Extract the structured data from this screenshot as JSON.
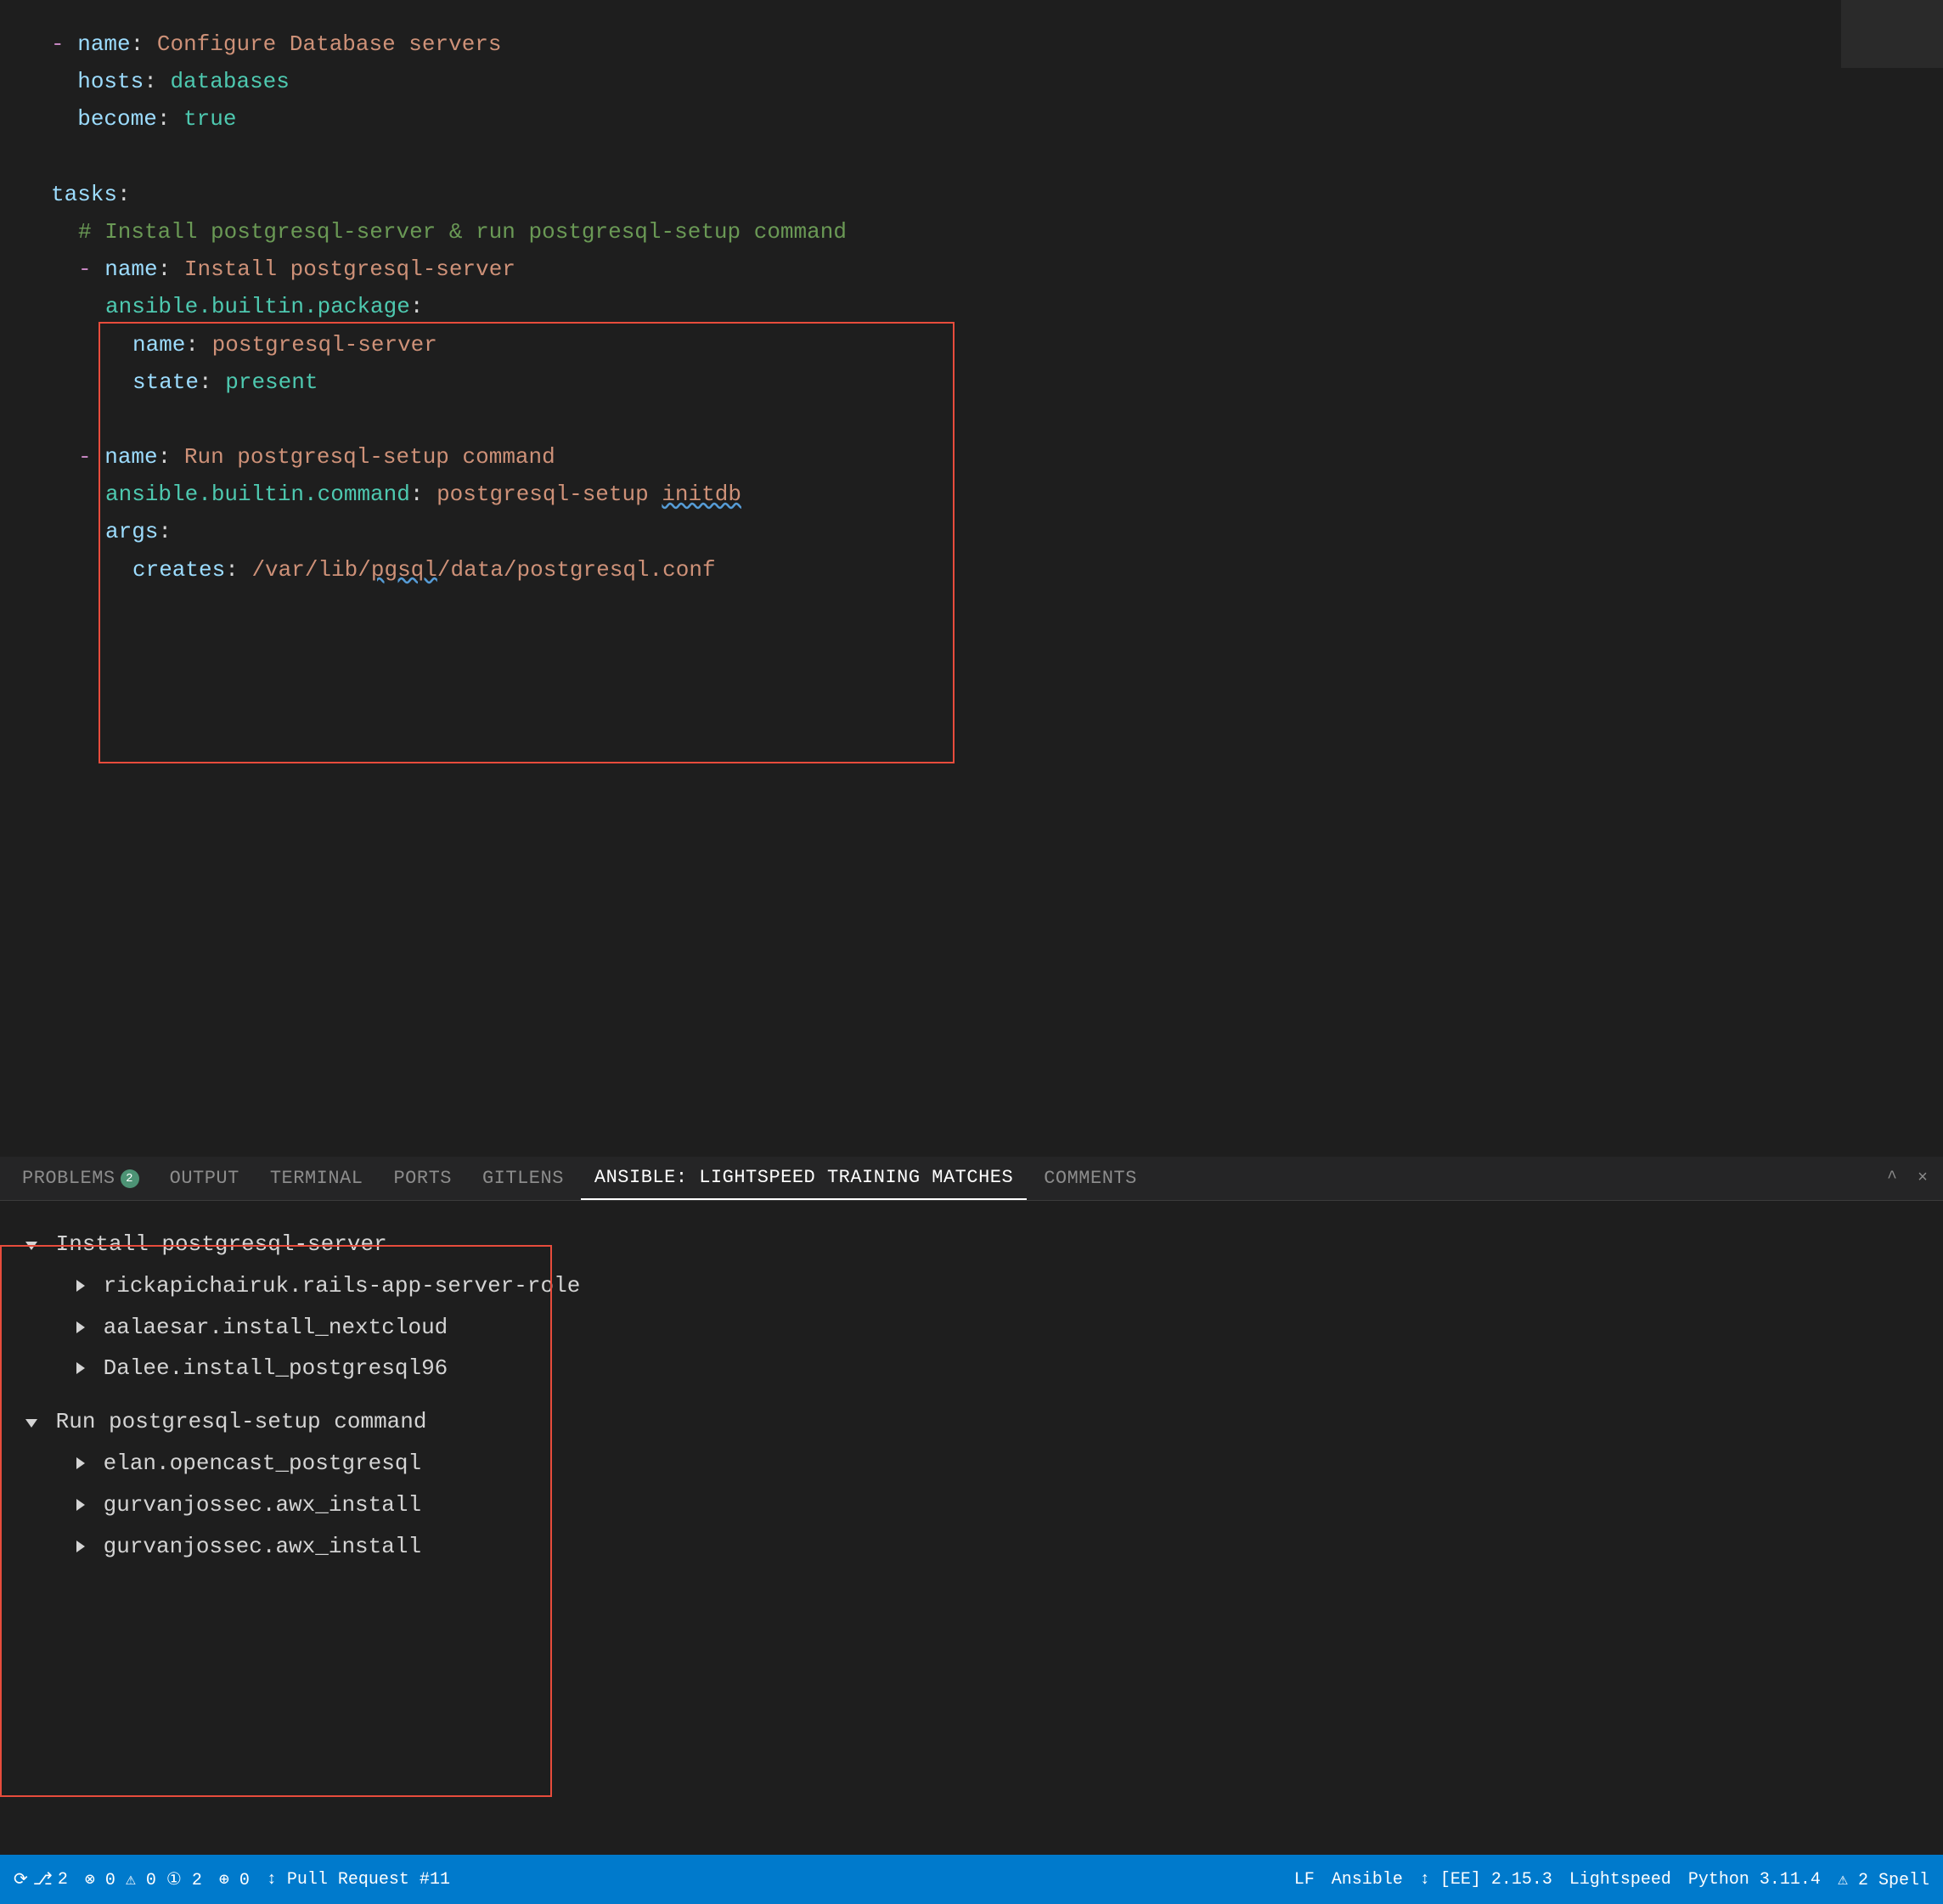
{
  "editor": {
    "lines": [
      {
        "indent": 0,
        "content": [
          {
            "type": "dash",
            "text": "- "
          },
          {
            "type": "key",
            "text": "name"
          },
          {
            "type": "plain",
            "text": ": "
          },
          {
            "type": "val-str",
            "text": "Configure Database servers"
          }
        ]
      },
      {
        "indent": 2,
        "content": [
          {
            "type": "key",
            "text": "hosts"
          },
          {
            "type": "plain",
            "text": ": "
          },
          {
            "type": "val-kw",
            "text": "databases"
          }
        ]
      },
      {
        "indent": 2,
        "content": [
          {
            "type": "key",
            "text": "become"
          },
          {
            "type": "plain",
            "text": ": "
          },
          {
            "type": "val-kw",
            "text": "true"
          }
        ]
      },
      {
        "indent": 0,
        "content": []
      },
      {
        "indent": 0,
        "content": [
          {
            "type": "key",
            "text": "tasks"
          },
          {
            "type": "plain",
            "text": ":"
          }
        ]
      },
      {
        "indent": 2,
        "content": [
          {
            "type": "comment",
            "text": "# Install postgresql-server & run postgresql-setup command"
          }
        ]
      },
      {
        "indent": 2,
        "content": [
          {
            "type": "dash",
            "text": "- "
          },
          {
            "type": "key",
            "text": "name"
          },
          {
            "type": "plain",
            "text": ": "
          },
          {
            "type": "val-str",
            "text": "Install postgresql-server"
          }
        ]
      },
      {
        "indent": 4,
        "content": [
          {
            "type": "module",
            "text": "ansible.builtin.package"
          },
          {
            "type": "plain",
            "text": ":"
          }
        ]
      },
      {
        "indent": 6,
        "content": [
          {
            "type": "key",
            "text": "name"
          },
          {
            "type": "plain",
            "text": ": "
          },
          {
            "type": "val-str",
            "text": "postgresql-server"
          }
        ]
      },
      {
        "indent": 6,
        "content": [
          {
            "type": "key",
            "text": "state"
          },
          {
            "type": "plain",
            "text": ": "
          },
          {
            "type": "val-kw",
            "text": "present"
          }
        ]
      },
      {
        "indent": 0,
        "content": []
      },
      {
        "indent": 2,
        "content": [
          {
            "type": "dash",
            "text": "- "
          },
          {
            "type": "key",
            "text": "name"
          },
          {
            "type": "plain",
            "text": ": "
          },
          {
            "type": "val-str",
            "text": "Run postgresql-setup command"
          }
        ]
      },
      {
        "indent": 4,
        "content": [
          {
            "type": "module",
            "text": "ansible.builtin.command"
          },
          {
            "type": "plain",
            "text": ": "
          },
          {
            "type": "val-str",
            "text": "postgresql-setup "
          },
          {
            "type": "underline",
            "text": "initdb"
          }
        ]
      },
      {
        "indent": 4,
        "content": [
          {
            "type": "key",
            "text": "args"
          },
          {
            "type": "plain",
            "text": ":"
          }
        ]
      },
      {
        "indent": 6,
        "content": [
          {
            "type": "key",
            "text": "creates"
          },
          {
            "type": "plain",
            "text": ": "
          },
          {
            "type": "path",
            "text": "/var/lib/"
          },
          {
            "type": "underline-path",
            "text": "pgsql"
          },
          {
            "type": "path",
            "text": "/data/postgresql.conf"
          }
        ]
      }
    ]
  },
  "tabs": {
    "items": [
      {
        "label": "PROBLEMS",
        "badge": "2",
        "active": false
      },
      {
        "label": "OUTPUT",
        "active": false
      },
      {
        "label": "TERMINAL",
        "active": false
      },
      {
        "label": "PORTS",
        "active": false
      },
      {
        "label": "GITLENS",
        "active": false
      },
      {
        "label": "ANSIBLE: LIGHTSPEED TRAINING MATCHES",
        "active": true
      },
      {
        "label": "COMMENTS",
        "active": false
      }
    ],
    "collapse_label": "^",
    "close_label": "×"
  },
  "panel": {
    "tree": [
      {
        "type": "parent",
        "label": "Install postgresql-server",
        "collapsed": false,
        "children": [
          "rickapichairuk.rails-app-server-role",
          "aalaesar.install_nextcloud",
          "Dalee.install_postgresql96"
        ]
      },
      {
        "type": "parent",
        "label": "Run postgresql-setup command",
        "collapsed": false,
        "children": [
          "elan.opencast_postgresql",
          "gurvanjossec.awx_install",
          "gurvanjossec.awx_install"
        ]
      }
    ]
  },
  "statusbar": {
    "sync_icon": "⟳",
    "branch_icon": "⎇",
    "branch": "2",
    "errors": "⊗ 0",
    "warnings": "⚠ 0",
    "info": "① 2",
    "ports": "⊕ 0",
    "pull_request": "↕ Pull Request #11",
    "encoding": "LF",
    "language": "Ansible",
    "ee_version": "↕ [EE] 2.15.3",
    "lightspeed": "Lightspeed",
    "python": "Python 3.11.4",
    "spell": "⚠ 2 Spell"
  }
}
